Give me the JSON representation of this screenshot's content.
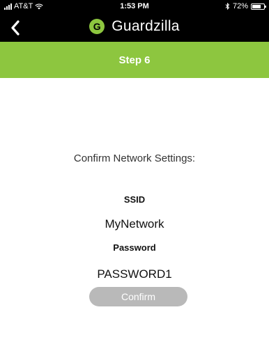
{
  "status_bar": {
    "carrier": "AT&T",
    "time": "1:53 PM",
    "battery": "72%",
    "battery_level": 0.72
  },
  "nav": {
    "app_name": "Guardzilla",
    "logo_letter": "G"
  },
  "step": {
    "title": "Step 6"
  },
  "main": {
    "heading": "Confirm Network Settings:",
    "ssid_label": "SSID",
    "ssid_value": "MyNetwork",
    "password_label": "Password",
    "password_value": "PASSWORD1",
    "confirm_label": "Confirm"
  },
  "colors": {
    "brand_green": "#8dc63f",
    "header_black": "#000000",
    "button_disabled_gray": "#b9b9b9"
  }
}
